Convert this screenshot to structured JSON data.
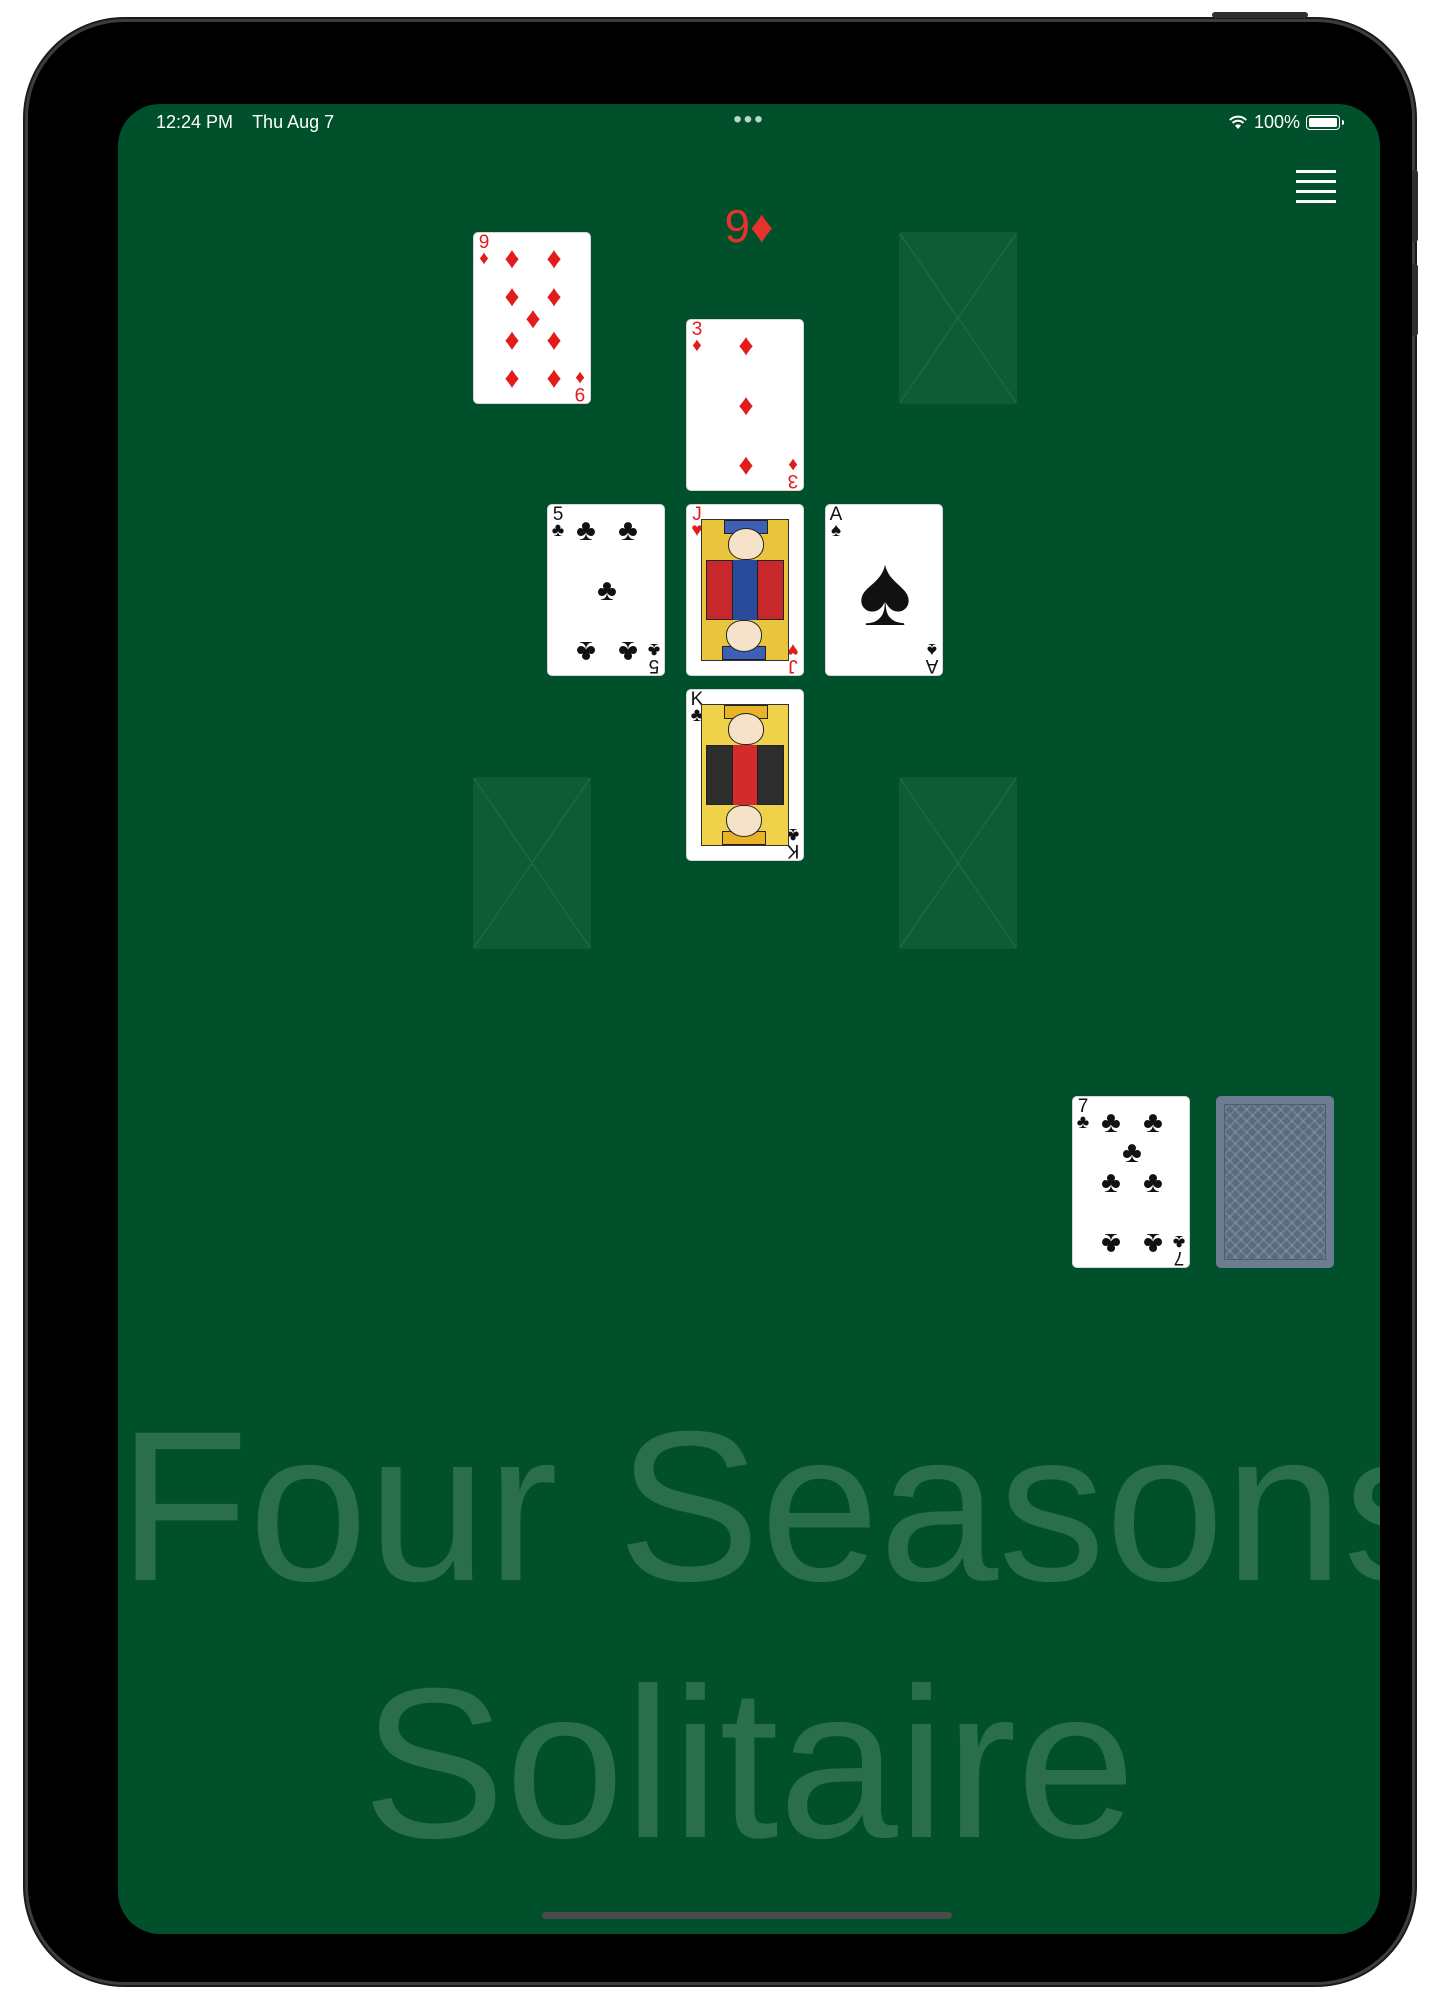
{
  "status_bar": {
    "time": "12:24 PM",
    "date": "Thu Aug 7",
    "dots": "•••",
    "wifi_icon": "wifi-icon",
    "battery": "100%"
  },
  "menu": {
    "icon": "hamburger-menu-icon"
  },
  "target": {
    "rank": "9",
    "suit": "♦"
  },
  "cards": {
    "nine_diamonds": {
      "rank": "9",
      "suit": "♦"
    },
    "three_diamonds": {
      "rank": "3",
      "suit": "♦"
    },
    "five_clubs": {
      "rank": "5",
      "suit": "♣"
    },
    "jack_hearts": {
      "rank": "J",
      "suit": "♥"
    },
    "ace_spades": {
      "rank": "A",
      "suit": "♠"
    },
    "king_clubs": {
      "rank": "K",
      "suit": "♣"
    },
    "seven_clubs": {
      "rank": "7",
      "suit": "♣"
    }
  },
  "stock": {
    "icon": "card-back-icon"
  },
  "watermark": {
    "line1": "Four Seasons",
    "line2": "Solitaire"
  },
  "colors": {
    "felt": "#00502b",
    "red": "#e21b1b",
    "watermark": "#2a6e4c"
  }
}
